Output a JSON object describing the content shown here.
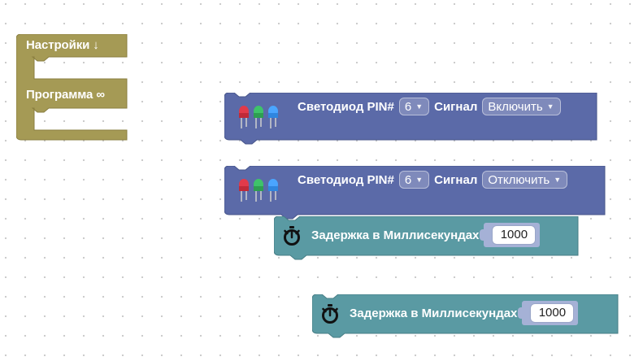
{
  "blocks": {
    "setup_loop": {
      "setup_label": "Настройки ↓",
      "loop_label": "Программа ∞",
      "color": "#a59a55"
    },
    "led_on": {
      "label": "Светодиод PIN#",
      "pin": "6",
      "signal_label": "Сигнал",
      "signal_value": "Включить",
      "color": "#5b6aa8"
    },
    "led_off": {
      "label": "Светодиод PIN#",
      "pin": "6",
      "signal_label": "Сигнал",
      "signal_value": "Отключить",
      "color": "#5b6aa8"
    },
    "delay_1": {
      "label": "Задержка в Миллисекундах",
      "value": "1000",
      "color": "#5a9aa3"
    },
    "delay_2": {
      "label": "Задержка в Миллисекундах",
      "value": "1000",
      "color": "#5a9aa3"
    }
  },
  "icons": {
    "led": "led-rgb-icon",
    "timer": "stopwatch-icon"
  }
}
